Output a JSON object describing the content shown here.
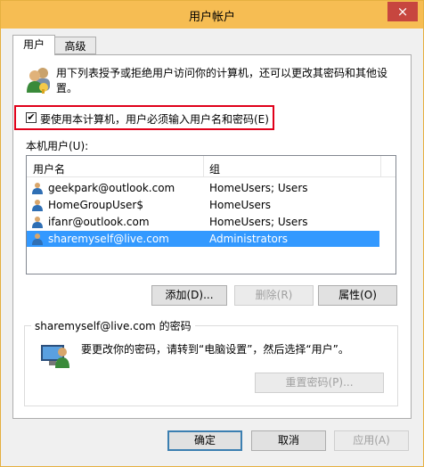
{
  "window": {
    "title": "用户帐户",
    "close_icon": "×"
  },
  "tabs": [
    {
      "label": "用户",
      "active": true
    },
    {
      "label": "高级",
      "active": false
    }
  ],
  "intro": "用下列表授予或拒绝用户访问你的计算机，还可以更改其密码和其他设置。",
  "require_login": {
    "label": "要使用本计算机，用户必须输入用户名和密码(E)",
    "checked": true,
    "checkmark": "✔"
  },
  "local_users_label": "本机用户(U):",
  "table": {
    "headers": [
      "用户名",
      "组"
    ],
    "rows": [
      {
        "name": "geekpark@outlook.com",
        "group": "HomeUsers; Users",
        "selected": false
      },
      {
        "name": "HomeGroupUser$",
        "group": "HomeUsers",
        "selected": false
      },
      {
        "name": "ifanr@outlook.com",
        "group": "HomeUsers; Users",
        "selected": false
      },
      {
        "name": "sharemyself@live.com",
        "group": "Administrators",
        "selected": true
      }
    ]
  },
  "list_buttons": {
    "add": "添加(D)...",
    "remove": "删除(R)",
    "properties": "属性(O)"
  },
  "password_group": {
    "title": "sharemyself@live.com 的密码",
    "text": "要更改你的密码，请转到“电脑设置”，然后选择“用户”。",
    "reset_button": "重置密码(P)..."
  },
  "dialog_buttons": {
    "ok": "确定",
    "cancel": "取消",
    "apply": "应用(A)"
  },
  "colors": {
    "titlebar": "#f6bd53",
    "selection": "#3399ff",
    "highlight_box": "#e0001a",
    "close": "#c7463f"
  }
}
